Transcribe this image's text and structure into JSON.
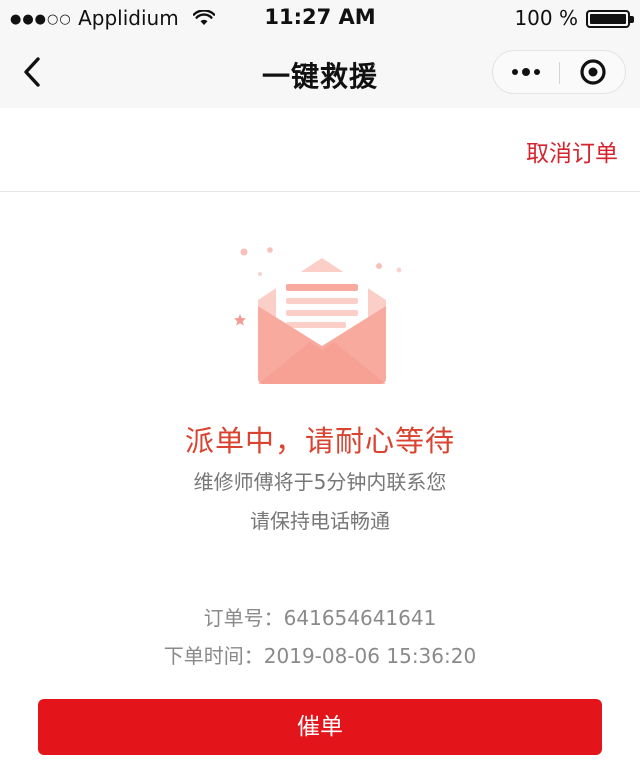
{
  "status_bar": {
    "carrier": "Applidium",
    "signal": "●●●○○",
    "time": "11:27 AM",
    "battery": "100 %"
  },
  "nav": {
    "title": "一键救援"
  },
  "actions": {
    "cancel_order": "取消订单"
  },
  "status": {
    "title": "派单中，请耐心等待",
    "line1": "维修师傅将于5分钟内联系您",
    "line2": "请保持电话畅通"
  },
  "order": {
    "number": "订单号：641654641641",
    "time": "下单时间：2019-08-06 15:36:20"
  },
  "footer": {
    "urge_button": "催单"
  },
  "colors": {
    "accent": "#e4141b",
    "status_text": "#d9432f",
    "envelope": "#f8aa9f"
  }
}
